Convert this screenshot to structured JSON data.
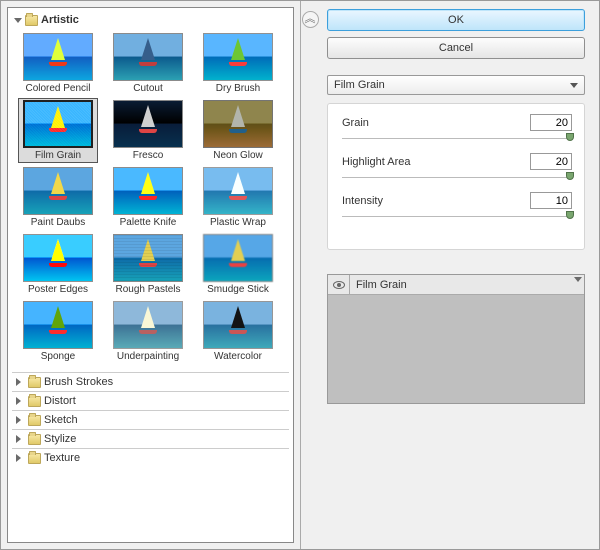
{
  "left": {
    "open_category": "Artistic",
    "filters": [
      {
        "label": "Colored Pencil",
        "cls": "f-pencil",
        "sail": "#e6e04b"
      },
      {
        "label": "Cutout",
        "cls": "f-cutout",
        "sail": "#3a6aa0"
      },
      {
        "label": "Dry Brush",
        "cls": "f-drybrush",
        "sail": "#6cb23e"
      },
      {
        "label": "Film Grain",
        "cls": "f-filmgrain",
        "sail": "#f2d84a",
        "selected": true
      },
      {
        "label": "Fresco",
        "cls": "f-fresco",
        "sail": "#d0d0d0"
      },
      {
        "label": "Neon Glow",
        "cls": "f-neon",
        "sail": "#cfd3e0"
      },
      {
        "label": "Paint Daubs",
        "cls": "",
        "sail": "#f2d84a"
      },
      {
        "label": "Palette Knife",
        "cls": "f-pknife",
        "sail": "#e0d83a"
      },
      {
        "label": "Plastic Wrap",
        "cls": "f-pwrap",
        "sail": "#d8e2e8"
      },
      {
        "label": "Poster Edges",
        "cls": "f-poster",
        "sail": "#efd63c"
      },
      {
        "label": "Rough Pastels",
        "cls": "f-rough",
        "sail": "#e2cf52"
      },
      {
        "label": "Smudge Stick",
        "cls": "f-smudge",
        "sail": "#e0cf5e"
      },
      {
        "label": "Sponge",
        "cls": "f-sponge",
        "sail": "#6c9a32"
      },
      {
        "label": "Underpainting",
        "cls": "f-under",
        "sail": "#dcd8a0"
      },
      {
        "label": "Watercolor",
        "cls": "f-water",
        "sail": "#111"
      }
    ],
    "collapsed_categories": [
      "Brush Strokes",
      "Distort",
      "Sketch",
      "Stylize",
      "Texture"
    ]
  },
  "right": {
    "ok_label": "OK",
    "cancel_label": "Cancel",
    "dropdown_value": "Film Grain",
    "params": [
      {
        "label": "Grain",
        "value": "20",
        "pos": 99
      },
      {
        "label": "Highlight Area",
        "value": "20",
        "pos": 99
      },
      {
        "label": "Intensity",
        "value": "10",
        "pos": 99
      }
    ],
    "layers": [
      {
        "name": "Film Grain"
      }
    ]
  }
}
